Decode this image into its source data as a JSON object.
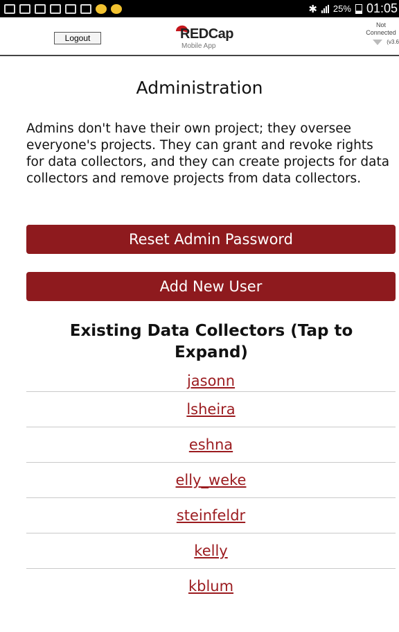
{
  "status_bar": {
    "bluetooth": "✱",
    "battery_percent": "25%",
    "time": "01:05"
  },
  "header": {
    "logout_label": "Logout",
    "logo_text": "REDCap",
    "logo_subtitle": "Mobile App",
    "connection_status": "Not Connected",
    "version": "(v3.6"
  },
  "main": {
    "title": "Administration",
    "intro": "Admins don't have their own project; they oversee everyone's projects. They can grant and revoke rights for data collectors, and they can create projects for data collectors and remove projects from data collectors.",
    "reset_password_label": "Reset Admin Password",
    "add_user_label": "Add New User",
    "collectors_title": "Existing Data Collectors (Tap to Expand)",
    "collectors": [
      "jasonn",
      "lsheira",
      "eshna",
      "elly_weke",
      "steinfeldr",
      "kelly",
      "kblum"
    ]
  },
  "colors": {
    "brand_red": "#8e1a1e",
    "link_red": "#9b1b1f"
  }
}
